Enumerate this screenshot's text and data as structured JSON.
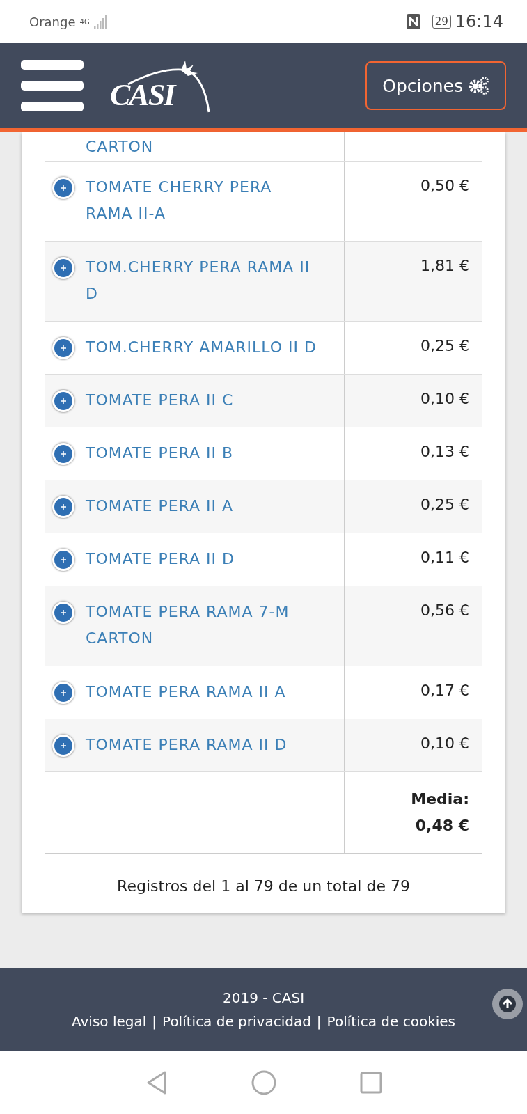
{
  "status_bar": {
    "carrier": "Orange",
    "network": "4G",
    "battery": "29",
    "time": "16:14"
  },
  "header": {
    "logo": "CASI",
    "options_button": "Opciones"
  },
  "table": {
    "rows": [
      {
        "name": "CARTON"
      },
      {
        "name": "TOMATE CHERRY PERA RAMA II-A",
        "price": "0,50 €"
      },
      {
        "name": "TOM.CHERRY PERA RAMA II D",
        "price": "1,81 €"
      },
      {
        "name": "TOM.CHERRY AMARILLO II D",
        "price": "0,25 €"
      },
      {
        "name": "TOMATE PERA II C",
        "price": "0,10 €"
      },
      {
        "name": "TOMATE PERA II B",
        "price": "0,13 €"
      },
      {
        "name": "TOMATE PERA II A",
        "price": "0,25 €"
      },
      {
        "name": "TOMATE PERA II D",
        "price": "0,11 €"
      },
      {
        "name": "TOMATE PERA RAMA 7-M CARTON",
        "price": "0,56 €"
      },
      {
        "name": "TOMATE PERA RAMA II A",
        "price": "0,17 €"
      },
      {
        "name": "TOMATE PERA RAMA II D",
        "price": "0,10 €"
      }
    ],
    "summary": {
      "label": "Media:",
      "value": "0,48 €"
    },
    "records": "Registros del 1 al 79 de un total de 79"
  },
  "footer": {
    "copyright": "2019 - CASI",
    "links": [
      "Aviso legal",
      "Política de privacidad",
      "Política de cookies"
    ],
    "separator": "|"
  }
}
